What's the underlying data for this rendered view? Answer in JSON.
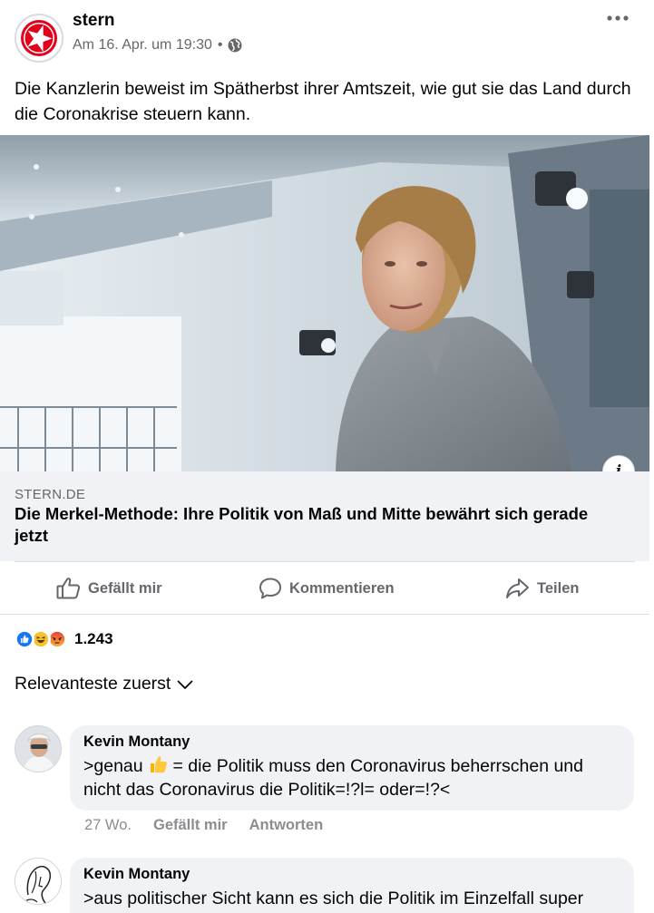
{
  "post": {
    "author": "stern",
    "timestamp": "Am 16. Apr. um 19:30",
    "separator": "•",
    "privacy_icon": "globe-icon",
    "text": "Die Kanzlerin beweist im Spätherbst ihrer Amtszeit, wie gut sie das Land durch die Coronakrise steuern kann."
  },
  "link": {
    "domain": "STERN.DE",
    "title": "Die Merkel-Methode: Ihre Politik von Maß und Mitte bewährt sich gerade jetzt",
    "info_label": "i"
  },
  "actions": {
    "like": "Gefällt mir",
    "comment": "Kommentieren",
    "share": "Teilen"
  },
  "reactions": {
    "types": [
      "like",
      "haha",
      "angry"
    ],
    "count": "1.243"
  },
  "sort": {
    "label": "Relevanteste zuerst"
  },
  "comments": [
    {
      "author": "Kevin Montany",
      "text_before": ">genau",
      "text_after": " = die Politik muss den Coronavirus beherrschen und nicht das Coronavirus die Politik=!?l= oder=!?<",
      "age": "27 Wo.",
      "like": "Gefällt mir",
      "reply": "Antworten"
    },
    {
      "author": "Kevin Montany",
      "text": ">aus politischer Sicht kann es sich die Politik im Einzelfall super"
    }
  ],
  "colors": {
    "stern_red": "#e2001a",
    "fb_blue": "#1877f2",
    "secondary_text": "#65676b",
    "bubble_bg": "#f0f2f5"
  }
}
